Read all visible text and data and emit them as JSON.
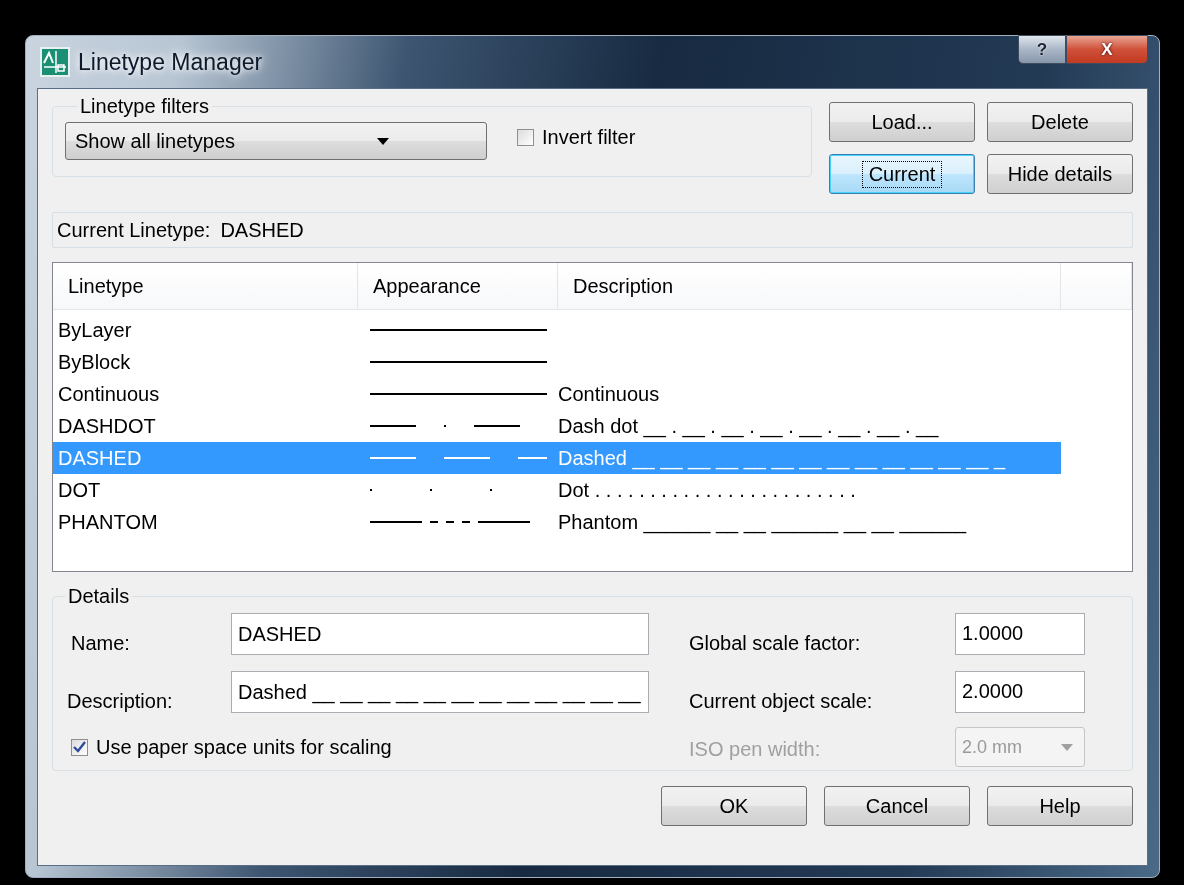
{
  "window": {
    "title": "Linetype Manager",
    "help_button": "?",
    "close_button": "X"
  },
  "filters": {
    "label": "Linetype filters",
    "dropdown": "Show all linetypes",
    "invert": {
      "label": "Invert filter",
      "checked": false
    }
  },
  "top_buttons": [
    {
      "label": "Load...",
      "focused": false
    },
    {
      "label": "Delete",
      "focused": false
    },
    {
      "label": "Current",
      "focused": true
    },
    {
      "label": "Hide details",
      "focused": false
    }
  ],
  "current_linetype": {
    "label": "Current Linetype:",
    "value": "DASHED"
  },
  "table": {
    "columns": [
      "Linetype",
      "Appearance",
      "Description"
    ],
    "rows": [
      {
        "linetype": "ByLayer",
        "kind": "continuous",
        "selected": false
      },
      {
        "linetype": "ByBlock",
        "kind": "continuous",
        "selected": false
      },
      {
        "linetype": "Continuous",
        "kind": "continuous",
        "description": "Continuous",
        "selected": false
      },
      {
        "linetype": "DASHDOT",
        "kind": "dashdot",
        "description": "Dash dot __ . __ . __ . __ . __ . __ . __ . __",
        "selected": false
      },
      {
        "linetype": "DASHED",
        "kind": "dashed",
        "description": "Dashed __ __ __ __ __ __ __ __ __ __ __ __ __ _",
        "selected": true
      },
      {
        "linetype": "DOT",
        "kind": "dot",
        "description": "Dot . . . . . . . . . . . . . . . . . . . . . . . .",
        "selected": false
      },
      {
        "linetype": "PHANTOM",
        "kind": "phantom",
        "description": "Phantom ______ __ __ ______ __ __ ______",
        "selected": false
      }
    ]
  },
  "details": {
    "label": "Details",
    "name": {
      "label": "Name:",
      "value": "DASHED"
    },
    "description": {
      "label": "Description:",
      "value": "Dashed __ __ __ __ __ __ __ __ __ __ __ __"
    },
    "paper_space": {
      "label": "Use paper space units for scaling",
      "checked": true
    },
    "global_scale": {
      "label": "Global scale factor:",
      "value": "1.0000"
    },
    "object_scale": {
      "label": "Current object scale:",
      "value": "2.0000"
    },
    "pen_width": {
      "label": "ISO pen width:",
      "value": "2.0 mm",
      "disabled": true
    }
  },
  "buttons": [
    "OK",
    "Cancel",
    "Help"
  ]
}
